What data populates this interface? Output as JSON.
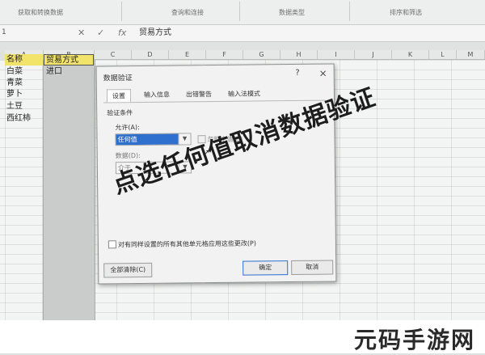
{
  "ribbon": {
    "groups": [
      "获取和转换数据",
      "查询和连接",
      "数据类型",
      "排序和筛选"
    ]
  },
  "formula_bar": {
    "name_box": "1",
    "content": "贸易方式"
  },
  "columns": [
    "A",
    "B",
    "C",
    "D",
    "E",
    "F",
    "G",
    "H",
    "I",
    "J",
    "K",
    "L",
    "M"
  ],
  "sheet": {
    "header_a": "名称",
    "header_b": "贸易方式",
    "b2": "进口",
    "col_a": [
      "白菜",
      "青菜",
      "萝卜",
      "土豆",
      "西红柿"
    ]
  },
  "dialog": {
    "title": "数据验证",
    "help": "?",
    "close": "×",
    "tabs": [
      "设置",
      "输入信息",
      "出错警告",
      "输入法模式"
    ],
    "section": "验证条件",
    "allow_label": "允许(A):",
    "allow_value": "任何值",
    "ignore_blank": "忽略空值(B)",
    "data_label": "数据(D):",
    "data_value": "介于",
    "apply_all": "对有同样设置的所有其他单元格应用这些更改(P)",
    "clear_all": "全部清除(C)",
    "ok": "确定",
    "cancel": "取消"
  },
  "overlay_text": "点选任何值取消数据验证",
  "watermark": "元码手游网"
}
